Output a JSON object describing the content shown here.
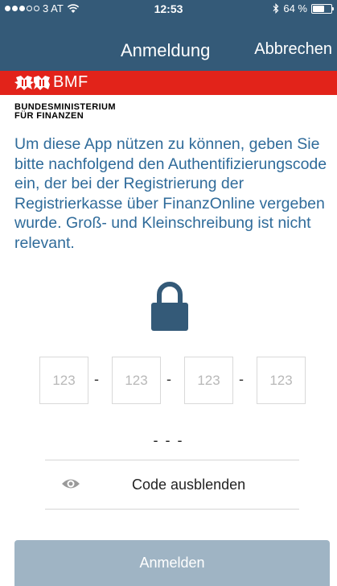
{
  "status_bar": {
    "carrier": "3 AT",
    "time": "12:53",
    "battery": "64 %",
    "battery_level": 0.64,
    "signal_bars": 3
  },
  "nav": {
    "title": "Anmeldung",
    "cancel_label": "Abbrechen"
  },
  "branding": {
    "logo_text": "BMF",
    "ministry_line1": "BUNDESMINISTERIUM",
    "ministry_line2": "FÜR FINANZEN",
    "brand_red": "#e2231a",
    "brand_blue": "#345a78"
  },
  "intro_text": "Um diese App nützen zu können, geben Sie bitte nachfolgend den Authentifizierungscode ein, der bei der Registrierung der Registrierkasse über FinanzOnline vergeben wurde. Groß- und Kleinschreibung ist nicht relevant.",
  "code_fields": [
    {
      "placeholder": "123"
    },
    {
      "placeholder": "123"
    },
    {
      "placeholder": "123"
    },
    {
      "placeholder": "123"
    }
  ],
  "separator": "-",
  "code_preview": "- - -",
  "toggle_label": "Code ausblenden",
  "login_label": "Anmelden",
  "icons": {
    "lock": "lock-icon",
    "eye": "eye-icon",
    "wifi": "wifi-icon",
    "bluetooth": "bluetooth-icon"
  }
}
